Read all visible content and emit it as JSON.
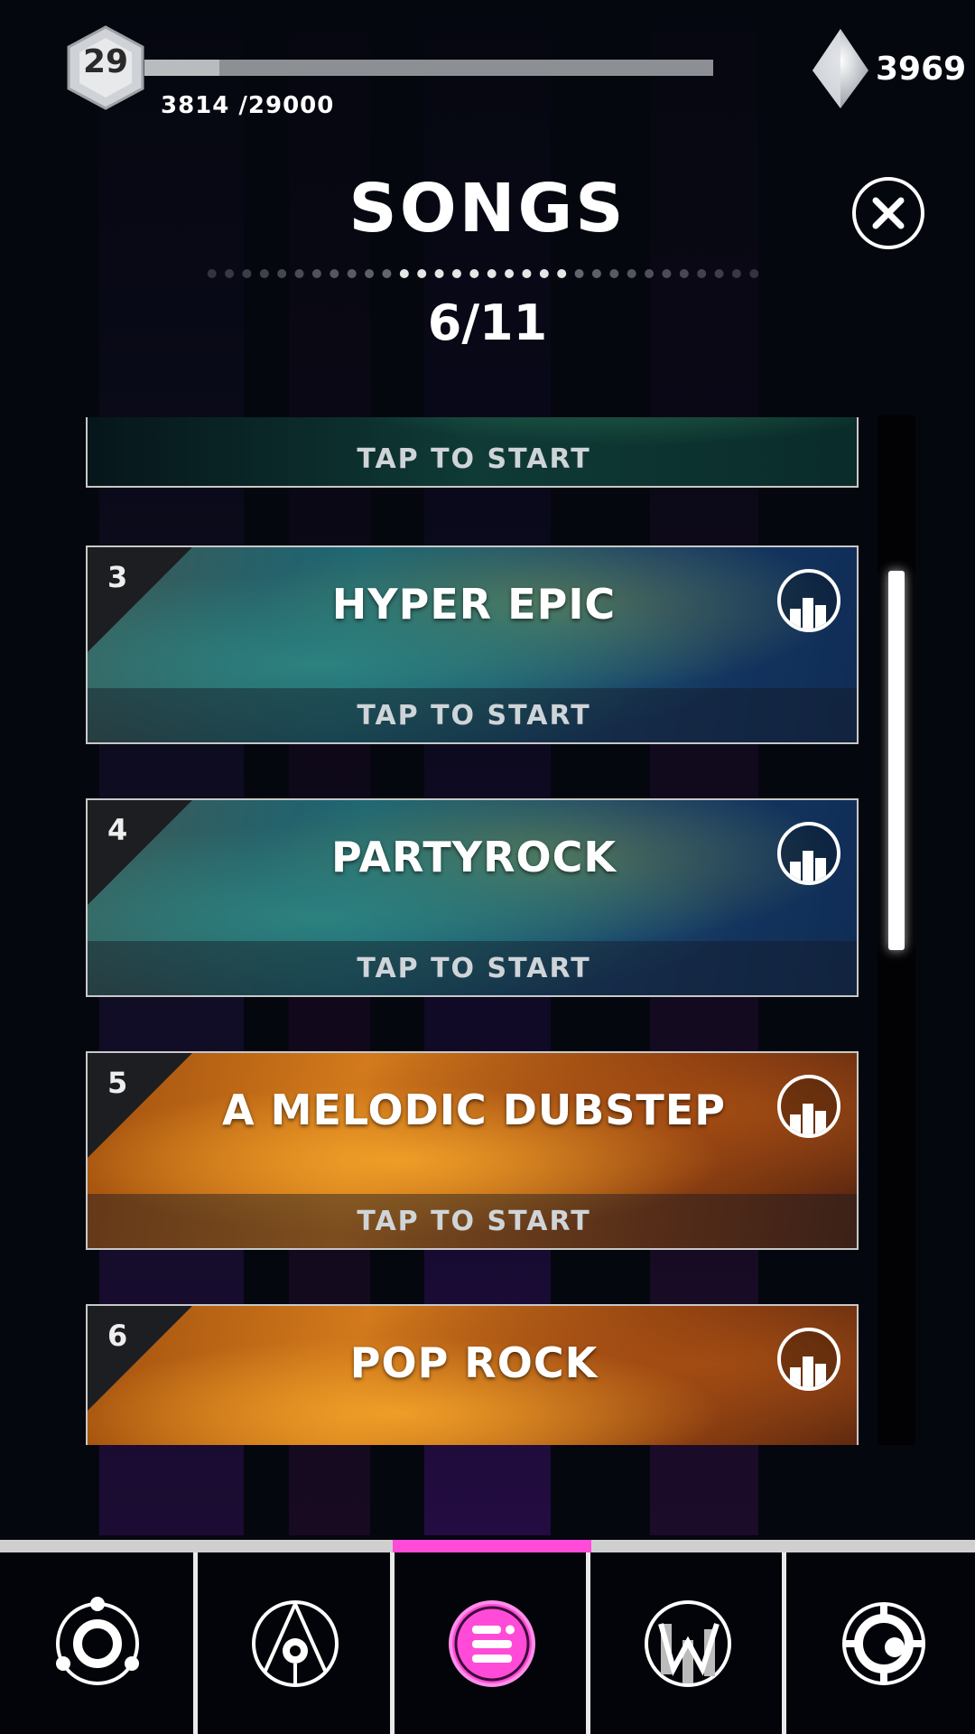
{
  "player": {
    "level": "29",
    "xp_text": "3814 /29000",
    "xp_progress": 0.1315,
    "gems": "3969"
  },
  "header": {
    "title": "SONGS",
    "page_counter": "6/11",
    "page_dots_total": 32,
    "page_dots_highlighted": 10
  },
  "songs": [
    {
      "number": "",
      "title": "",
      "start_label": "TAP TO START",
      "theme": "green"
    },
    {
      "number": "3",
      "title": "HYPER EPIC",
      "start_label": "TAP TO START",
      "theme": "teal"
    },
    {
      "number": "4",
      "title": "PARTYROCK",
      "start_label": "TAP TO START",
      "theme": "teal"
    },
    {
      "number": "5",
      "title": "A MELODIC DUBSTEP",
      "start_label": "TAP TO START",
      "theme": "orange"
    },
    {
      "number": "6",
      "title": "POP ROCK",
      "start_label": "",
      "theme": "orange"
    }
  ],
  "nav": {
    "active_index": 2,
    "items": [
      {
        "icon": "orbit-icon"
      },
      {
        "icon": "road-icon"
      },
      {
        "icon": "menu-list-icon"
      },
      {
        "icon": "equalizer-w-icon"
      },
      {
        "icon": "settings-gear-icon"
      }
    ]
  },
  "colors": {
    "accent": "#ff4bd8",
    "xp_bar": "#8c8f93"
  }
}
